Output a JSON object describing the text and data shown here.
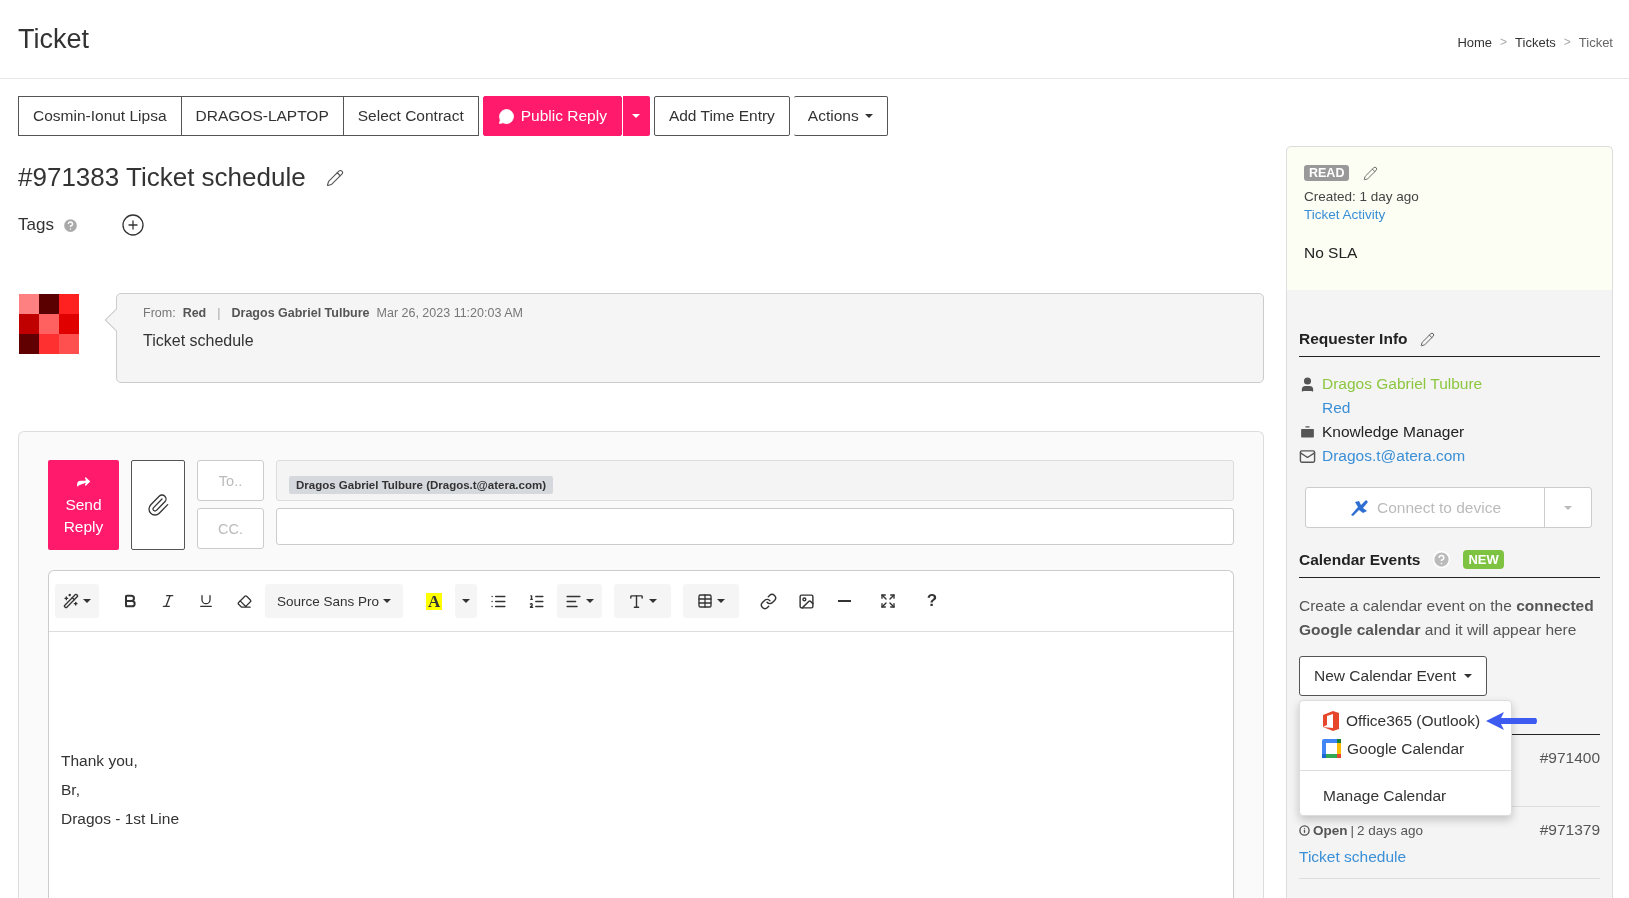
{
  "page": {
    "title": "Ticket",
    "breadcrumb_separator": ">",
    "breadcrumbs": [
      {
        "label": "Home",
        "current": false
      },
      {
        "label": "Tickets",
        "current": false
      },
      {
        "label": "Ticket",
        "current": true
      }
    ]
  },
  "toolbar": {
    "buttons": [
      {
        "label": "Cosmin-Ionut Lipsa",
        "kind": "group"
      },
      {
        "label": "DRAGOS-LAPTOP",
        "kind": "group"
      },
      {
        "label": "Select Contract",
        "kind": "group"
      },
      {
        "label": "Public Reply",
        "kind": "primary"
      },
      {
        "label": "Add Time Entry",
        "kind": "plain"
      },
      {
        "label": "Actions",
        "kind": "dropdown"
      }
    ]
  },
  "ticket": {
    "title": "#971383 Ticket schedule",
    "tags_label": "Tags"
  },
  "message": {
    "from_label": "From:",
    "from": "Red",
    "separator": "|",
    "author": "Dragos Gabriel Tulbure",
    "date": "Mar 26, 2023 11:20:03 AM",
    "body": "Ticket schedule"
  },
  "compose": {
    "send_label": "Send Reply",
    "to_label": "To..",
    "cc_label": "CC.",
    "recipients": [
      {
        "label": "Dragos Gabriel Tulbure (Dragos.t@atera.com)"
      }
    ],
    "font": "Source Sans Pro",
    "highlight_glyph": "A",
    "help_glyph": "?",
    "body_lines": [
      "Thank you,",
      "Br,",
      "Dragos - 1st Line"
    ]
  },
  "sidebar": {
    "status_badge": "READ",
    "created": "Created: 1 day ago",
    "activity_link": "Ticket Activity",
    "sla": "No SLA",
    "requester": {
      "heading": "Requester Info",
      "name": "Dragos Gabriel Tulbure",
      "company": "Red",
      "role": "Knowledge Manager",
      "email": "Dragos.t@atera.com"
    },
    "connect_button": {
      "label": "Connect to device",
      "disabled": true
    },
    "calendar": {
      "heading": "Calendar Events",
      "badge": "NEW",
      "description": "Create a calendar event on the **connected Google calendar** and it will appear here",
      "button": "New Calendar Event",
      "menu": {
        "open": true,
        "items": [
          {
            "label": "Office365 (Outlook)",
            "kind": "office",
            "pointed": true
          },
          {
            "label": "Google Calendar",
            "kind": "google",
            "pointed": false
          },
          {
            "label": "Manage Calendar",
            "kind": "plain",
            "pointed": false
          }
        ]
      }
    },
    "tickets": [
      {
        "number": "#971400"
      },
      {
        "status": "Open",
        "separator": "|",
        "age": "2 days ago",
        "number": "#971379",
        "title": "Ticket schedule"
      }
    ]
  }
}
